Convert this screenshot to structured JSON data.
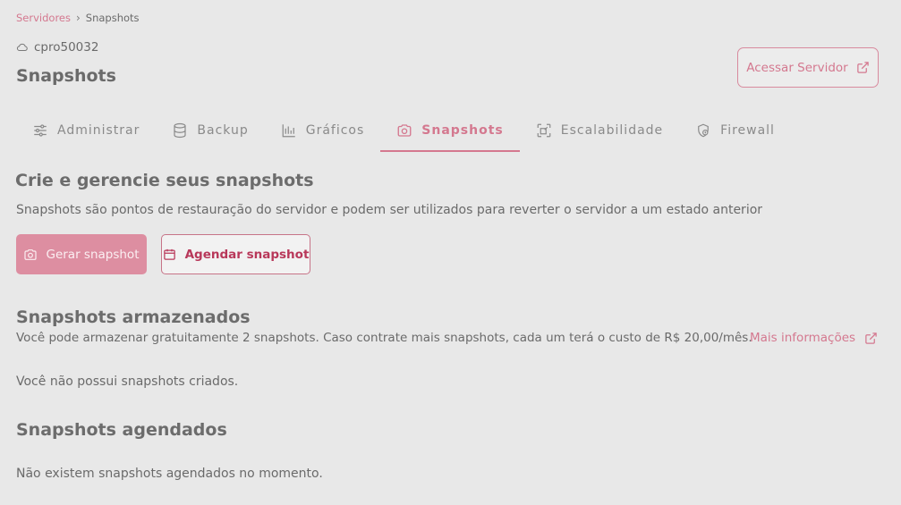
{
  "breadcrumb": {
    "parent": "Servidores",
    "current": "Snapshots"
  },
  "server": {
    "name": "cpro50032",
    "icon": "cloud-icon"
  },
  "page_title": "Snapshots",
  "header": {
    "access_button": "Acessar Servidor"
  },
  "tabs": [
    {
      "label": "Administrar",
      "icon": "sliders-icon",
      "active": false
    },
    {
      "label": "Backup",
      "icon": "database-icon",
      "active": false
    },
    {
      "label": "Gráficos",
      "icon": "bar-chart-icon",
      "active": false
    },
    {
      "label": "Snapshots",
      "icon": "camera-icon",
      "active": true
    },
    {
      "label": "Escalabilidade",
      "icon": "scale-icon",
      "active": false
    },
    {
      "label": "Firewall",
      "icon": "shield-icon",
      "active": false
    }
  ],
  "create_section": {
    "title": "Crie e gerencie seus snapshots",
    "description": "Snapshots são pontos de restauração do servidor e podem ser utilizados para reverter o servidor a um estado anterior",
    "generate_button": "Gerar snapshot",
    "schedule_button": "Agendar snapshot"
  },
  "stored_section": {
    "title": "Snapshots armazenados",
    "description": "Você pode armazenar gratuitamente 2 snapshots. Caso contrate mais snapshots, cada um terá o custo de R$ 20,00/mês.",
    "more_info_link": "Mais informações",
    "empty_message": "Você não possui snapshots criados."
  },
  "scheduled_section": {
    "title": "Snapshots agendados",
    "empty_message": "Não existem snapshots agendados no momento."
  },
  "colors": {
    "accent": "#d4788f",
    "accent_dark": "#b8385a",
    "background": "#e8e8e8",
    "text": "#6a6a6a"
  }
}
